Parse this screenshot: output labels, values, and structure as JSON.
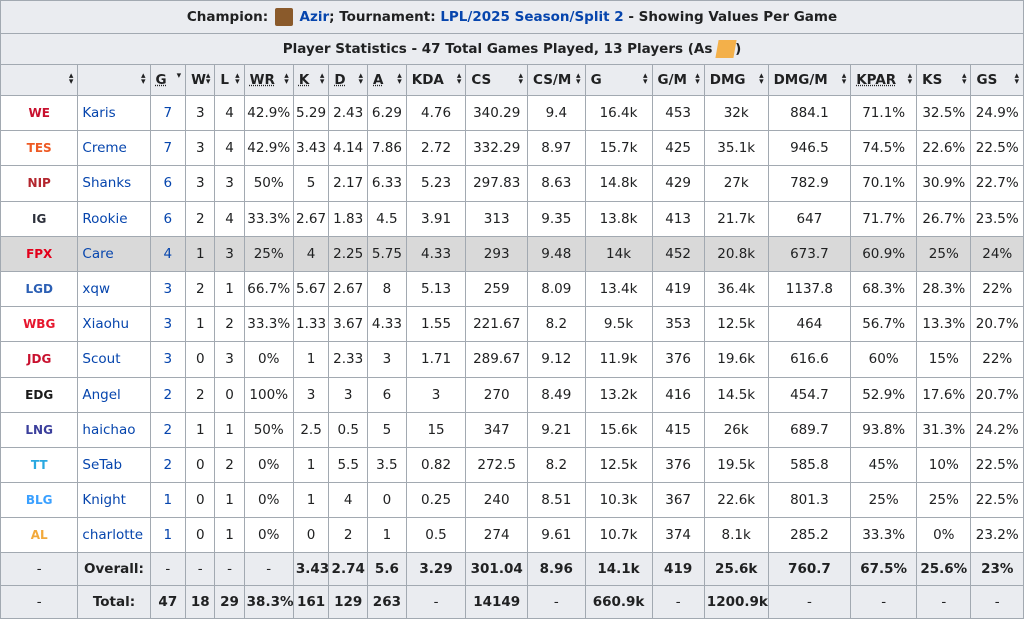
{
  "title": {
    "champion_label": "Champion:",
    "champion": "Azir",
    "tournament_label": "; Tournament:",
    "tournament": "LPL/2025 Season/Split 2",
    "suffix": " - Showing Values Per Game"
  },
  "subtitle": {
    "text": "Player Statistics - 47 Total Games Played, 13 Players (As",
    "close": ")"
  },
  "columns": [
    "",
    "",
    "G",
    "W",
    "L",
    "WR",
    "K",
    "D",
    "A",
    "KDA",
    "CS",
    "CS/M",
    "G",
    "G/M",
    "DMG",
    "DMG/M",
    "KPAR",
    "KS",
    "GS"
  ],
  "rows": [
    {
      "team": "WE",
      "team_color": "#c8102e",
      "player": "Karis",
      "g": "7",
      "w": "3",
      "l": "4",
      "wr": "42.9%",
      "k": "5.29",
      "d": "2.43",
      "a": "6.29",
      "kda": "4.76",
      "cs": "340.29",
      "csm": "9.4",
      "gold": "16.4k",
      "gm": "453",
      "dmg": "32k",
      "dmgm": "884.1",
      "kpar": "71.1%",
      "ks": "32.5%",
      "gs": "24.9%"
    },
    {
      "team": "TES",
      "team_color": "#ee5a24",
      "player": "Creme",
      "g": "7",
      "w": "3",
      "l": "4",
      "wr": "42.9%",
      "k": "3.43",
      "d": "4.14",
      "a": "7.86",
      "kda": "2.72",
      "cs": "332.29",
      "csm": "8.97",
      "gold": "15.7k",
      "gm": "425",
      "dmg": "35.1k",
      "dmgm": "946.5",
      "kpar": "74.5%",
      "ks": "22.6%",
      "gs": "22.5%"
    },
    {
      "team": "NIP",
      "team_color": "#b3262e",
      "player": "Shanks",
      "g": "6",
      "w": "3",
      "l": "3",
      "wr": "50%",
      "k": "5",
      "d": "2.17",
      "a": "6.33",
      "kda": "5.23",
      "cs": "297.83",
      "csm": "8.63",
      "gold": "14.8k",
      "gm": "429",
      "dmg": "27k",
      "dmgm": "782.9",
      "kpar": "70.1%",
      "ks": "30.9%",
      "gs": "22.7%"
    },
    {
      "team": "IG",
      "team_color": "#2b2f3a",
      "player": "Rookie",
      "g": "6",
      "w": "2",
      "l": "4",
      "wr": "33.3%",
      "k": "2.67",
      "d": "1.83",
      "a": "4.5",
      "kda": "3.91",
      "cs": "313",
      "csm": "9.35",
      "gold": "13.8k",
      "gm": "413",
      "dmg": "21.7k",
      "dmgm": "647",
      "kpar": "71.7%",
      "ks": "26.7%",
      "gs": "23.5%"
    },
    {
      "team": "FPX",
      "team_color": "#e3001b",
      "player": "Care",
      "g": "4",
      "w": "1",
      "l": "3",
      "wr": "25%",
      "k": "4",
      "d": "2.25",
      "a": "5.75",
      "kda": "4.33",
      "cs": "293",
      "csm": "9.48",
      "gold": "14k",
      "gm": "452",
      "dmg": "20.8k",
      "dmgm": "673.7",
      "kpar": "60.9%",
      "ks": "25%",
      "gs": "24%"
    },
    {
      "team": "LGD",
      "team_color": "#2b5fb4",
      "player": "xqw",
      "g": "3",
      "w": "2",
      "l": "1",
      "wr": "66.7%",
      "k": "5.67",
      "d": "2.67",
      "a": "8",
      "kda": "5.13",
      "cs": "259",
      "csm": "8.09",
      "gold": "13.4k",
      "gm": "419",
      "dmg": "36.4k",
      "dmgm": "1137.8",
      "kpar": "68.3%",
      "ks": "28.3%",
      "gs": "22%"
    },
    {
      "team": "WBG",
      "team_color": "#e6162d",
      "player": "Xiaohu",
      "g": "3",
      "w": "1",
      "l": "2",
      "wr": "33.3%",
      "k": "1.33",
      "d": "3.67",
      "a": "4.33",
      "kda": "1.55",
      "cs": "221.67",
      "csm": "8.2",
      "gold": "9.5k",
      "gm": "353",
      "dmg": "12.5k",
      "dmgm": "464",
      "kpar": "56.7%",
      "ks": "13.3%",
      "gs": "20.7%"
    },
    {
      "team": "JDG",
      "team_color": "#c8102e",
      "player": "Scout",
      "g": "3",
      "w": "0",
      "l": "3",
      "wr": "0%",
      "k": "1",
      "d": "2.33",
      "a": "3",
      "kda": "1.71",
      "cs": "289.67",
      "csm": "9.12",
      "gold": "11.9k",
      "gm": "376",
      "dmg": "19.6k",
      "dmgm": "616.6",
      "kpar": "60%",
      "ks": "15%",
      "gs": "22%"
    },
    {
      "team": "EDG",
      "team_color": "#1a1a1a",
      "player": "Angel",
      "g": "2",
      "w": "2",
      "l": "0",
      "wr": "100%",
      "k": "3",
      "d": "3",
      "a": "6",
      "kda": "3",
      "cs": "270",
      "csm": "8.49",
      "gold": "13.2k",
      "gm": "416",
      "dmg": "14.5k",
      "dmgm": "454.7",
      "kpar": "52.9%",
      "ks": "17.6%",
      "gs": "20.7%"
    },
    {
      "team": "LNG",
      "team_color": "#3b3f9c",
      "player": "haichao",
      "g": "2",
      "w": "1",
      "l": "1",
      "wr": "50%",
      "k": "2.5",
      "d": "0.5",
      "a": "5",
      "kda": "15",
      "cs": "347",
      "csm": "9.21",
      "gold": "15.6k",
      "gm": "415",
      "dmg": "26k",
      "dmgm": "689.7",
      "kpar": "93.8%",
      "ks": "31.3%",
      "gs": "24.2%"
    },
    {
      "team": "TT",
      "team_color": "#29a8e0",
      "player": "SeTab",
      "g": "2",
      "w": "0",
      "l": "2",
      "wr": "0%",
      "k": "1",
      "d": "5.5",
      "a": "3.5",
      "kda": "0.82",
      "cs": "272.5",
      "csm": "8.2",
      "gold": "12.5k",
      "gm": "376",
      "dmg": "19.5k",
      "dmgm": "585.8",
      "kpar": "45%",
      "ks": "10%",
      "gs": "22.5%"
    },
    {
      "team": "BLG",
      "team_color": "#3aa0ff",
      "player": "Knight",
      "g": "1",
      "w": "0",
      "l": "1",
      "wr": "0%",
      "k": "1",
      "d": "4",
      "a": "0",
      "kda": "0.25",
      "cs": "240",
      "csm": "8.51",
      "gold": "10.3k",
      "gm": "367",
      "dmg": "22.6k",
      "dmgm": "801.3",
      "kpar": "25%",
      "ks": "25%",
      "gs": "22.5%"
    },
    {
      "team": "AL",
      "team_color": "#f2a93b",
      "player": "charlotte",
      "g": "1",
      "w": "0",
      "l": "1",
      "wr": "0%",
      "k": "0",
      "d": "2",
      "a": "1",
      "kda": "0.5",
      "cs": "274",
      "csm": "9.61",
      "gold": "10.7k",
      "gm": "374",
      "dmg": "8.1k",
      "dmgm": "285.2",
      "kpar": "33.3%",
      "ks": "0%",
      "gs": "23.2%"
    }
  ],
  "highlight_player": "Care",
  "overall": [
    "-",
    "Overall:",
    "-",
    "-",
    "-",
    "-",
    "3.43",
    "2.74",
    "5.6",
    "3.29",
    "301.04",
    "8.96",
    "14.1k",
    "419",
    "25.6k",
    "760.7",
    "67.5%",
    "25.6%",
    "23%"
  ],
  "total": [
    "-",
    "Total:",
    "47",
    "18",
    "29",
    "38.3%",
    "161",
    "129",
    "263",
    "-",
    "14149",
    "-",
    "660.9k",
    "-",
    "1200.9k",
    "-",
    "-",
    "-",
    "-"
  ]
}
